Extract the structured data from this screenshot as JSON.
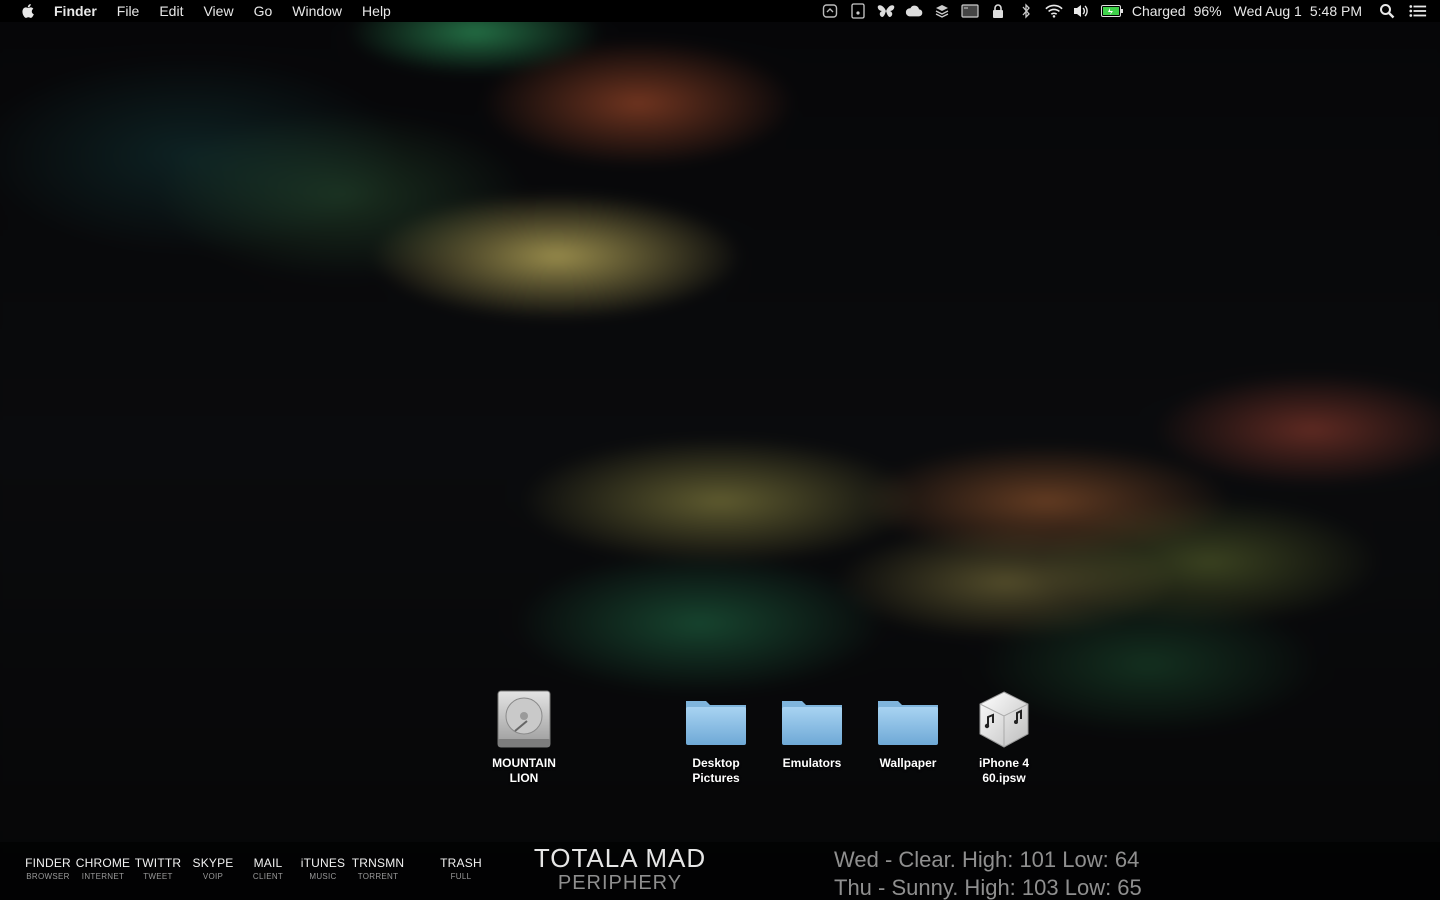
{
  "menubar": {
    "app_name": "Finder",
    "menus": [
      "File",
      "Edit",
      "View",
      "Go",
      "Window",
      "Help"
    ],
    "status_icons": [
      "dropzone-icon",
      "notes-icon",
      "butterfly-icon",
      "cloud-icon",
      "layers-icon",
      "terminal-icon",
      "lock-icon",
      "bluetooth-icon",
      "wifi-icon",
      "volume-icon",
      "battery-icon"
    ],
    "battery_status": "Charged",
    "battery_percent": "96%",
    "date": "Wed Aug 1",
    "time": "5:48 PM"
  },
  "desktop": {
    "icons": [
      {
        "label": "MOUNTAIN\nLION",
        "icon": "hard-drive-icon"
      },
      {
        "label": "Desktop\nPictures",
        "icon": "folder-icon"
      },
      {
        "label": "Emulators",
        "icon": "folder-icon"
      },
      {
        "label": "Wallpaper",
        "icon": "folder-icon"
      },
      {
        "label": "iPhone 4\n60.ipsw",
        "icon": "ipsw-file-icon"
      }
    ]
  },
  "dock": {
    "items": [
      {
        "name": "FINDER",
        "sub": "BROWSER"
      },
      {
        "name": "CHROME",
        "sub": "INTERNET"
      },
      {
        "name": "TWITTR",
        "sub": "TWEET"
      },
      {
        "name": "SKYPE",
        "sub": "VOIP"
      },
      {
        "name": "MAIL",
        "sub": "CLIENT"
      },
      {
        "name": "iTUNES",
        "sub": "MUSIC"
      },
      {
        "name": "TRNSMN",
        "sub": "TORRENT"
      },
      {
        "name": "TRASH",
        "sub": "FULL"
      }
    ],
    "now_playing": {
      "title": "TOTALA MAD",
      "artist": "PERIPHERY"
    },
    "weather": [
      "Wed - Clear. High: 101 Low: 64",
      "Thu - Sunny. High: 103 Low: 65"
    ]
  },
  "colors": {
    "menubar_bg": "#000000",
    "battery_green": "#3fd14a",
    "folder_blue": "#8fc1e6"
  }
}
